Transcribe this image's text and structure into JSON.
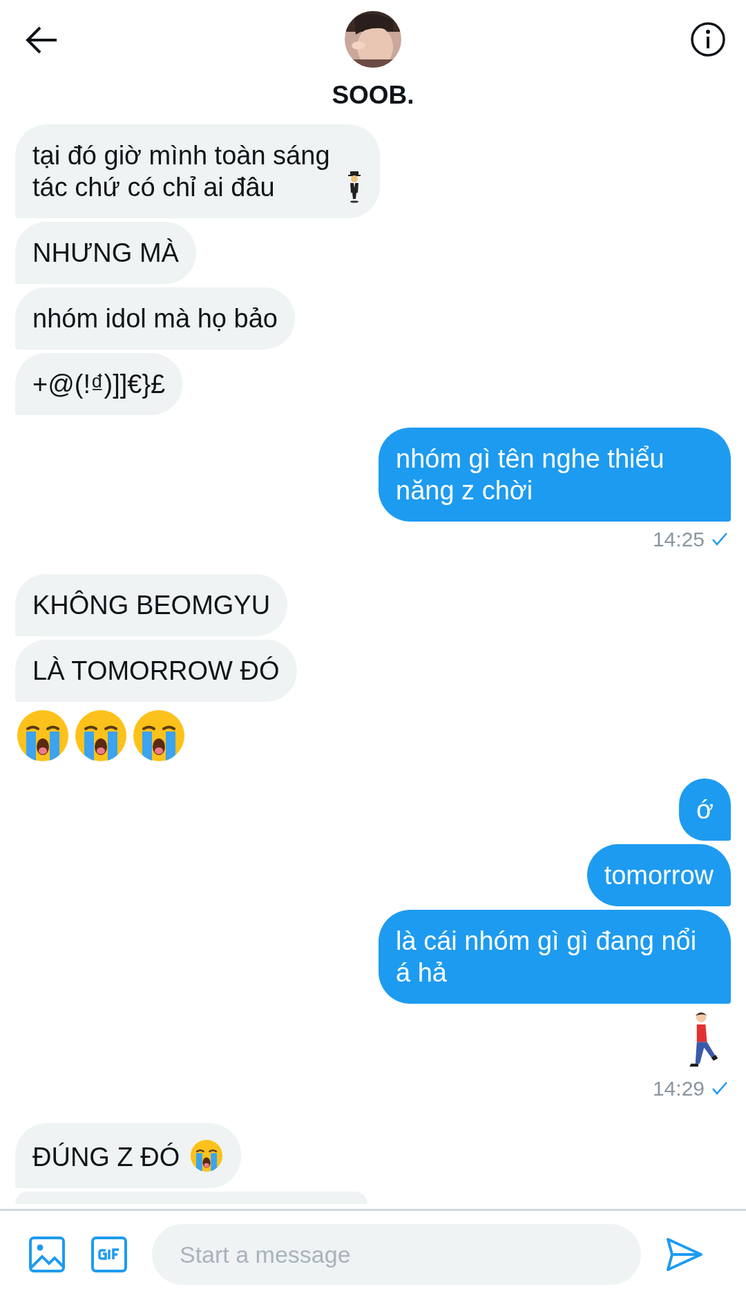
{
  "header": {
    "title": "SOOB."
  },
  "messages": [
    {
      "outgoing": false,
      "kind": "text",
      "text": "tại đó giờ mình toàn sáng tác chứ có chỉ ai đâu",
      "trailing": {
        "kind": "levitating"
      }
    },
    {
      "outgoing": false,
      "kind": "text",
      "text": "NHƯNG MÀ"
    },
    {
      "outgoing": false,
      "kind": "text",
      "text": "nhóm idol mà họ bảo"
    },
    {
      "outgoing": false,
      "kind": "text",
      "text": "+@(!₫)]]€}£"
    },
    {
      "outgoing": true,
      "kind": "text",
      "text": "nhóm gì tên nghe thiểu năng z chời"
    },
    {
      "outgoing": true,
      "kind": "time",
      "text": "14:25",
      "read": true
    },
    {
      "outgoing": false,
      "kind": "text",
      "text": "KHÔNG BEOMGYU"
    },
    {
      "outgoing": false,
      "kind": "text",
      "text": "LÀ TOMORROW ĐÓ"
    },
    {
      "outgoing": false,
      "kind": "emoji",
      "emojis": [
        {
          "kind": "crying"
        },
        {
          "kind": "crying"
        },
        {
          "kind": "crying"
        }
      ]
    },
    {
      "outgoing": true,
      "kind": "text",
      "text": "ớ"
    },
    {
      "outgoing": true,
      "kind": "text",
      "text": "tomorrow"
    },
    {
      "outgoing": true,
      "kind": "text",
      "text": "là cái nhóm gì gì đang nổi á hả"
    },
    {
      "outgoing": true,
      "kind": "emoji",
      "emojis": [
        {
          "kind": "walking"
        }
      ]
    },
    {
      "outgoing": true,
      "kind": "time",
      "text": "14:29",
      "read": true
    },
    {
      "outgoing": false,
      "kind": "text",
      "text": "ĐÚNG Z ĐÓ",
      "trailing": {
        "kind": "crying"
      }
    },
    {
      "outgoing": false,
      "kind": "cut"
    }
  ],
  "composer": {
    "placeholder": "Start a message"
  }
}
